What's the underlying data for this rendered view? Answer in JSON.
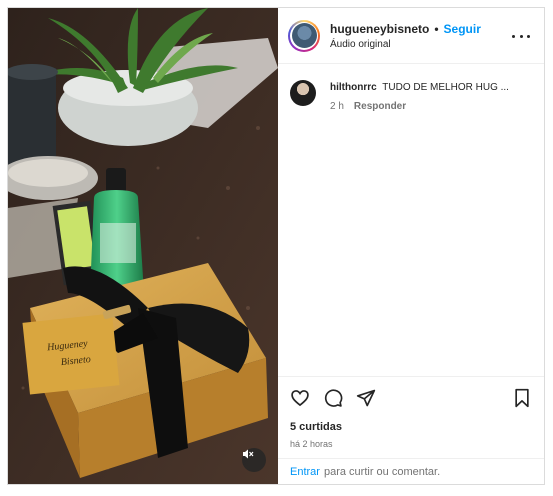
{
  "post": {
    "media": {
      "image_semantic": "gift box with black ribbon, mouthwash and toothpaste, potted plant on granite surface",
      "card_text_line1": "Hugueney",
      "card_text_line2": "Bisneto",
      "mute_icon": "mute-icon"
    },
    "header": {
      "username": "hugueneybisneto",
      "separator": "•",
      "follow_label": "Seguir",
      "audio_label": "Áudio original",
      "more_icon": "more-options-icon"
    },
    "comments": [
      {
        "user": "hilthonrrc",
        "text": "TUDO DE MELHOR HUG ...",
        "time": "2 h",
        "reply_label": "Responder"
      }
    ],
    "actions": {
      "like_icon": "heart-icon",
      "comment_icon": "comment-icon",
      "share_icon": "share-icon",
      "save_icon": "bookmark-icon"
    },
    "likes_label": "5 curtidas",
    "time_ago": "há 2 horas",
    "login_bar": {
      "enter_label": "Entrar",
      "rest_label": "para curtir ou comentar."
    },
    "colors": {
      "accent": "#0095f6",
      "text": "#262626",
      "muted": "#737373",
      "border": "#dbdbdb"
    }
  }
}
